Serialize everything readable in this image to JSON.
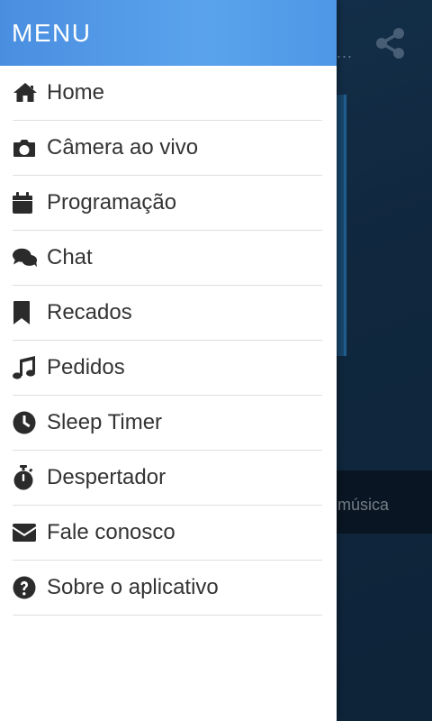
{
  "drawer": {
    "title": "MENU",
    "header_color": "#4e97e6"
  },
  "menu": [
    {
      "label": "Home",
      "icon": "home-icon"
    },
    {
      "label": "Câmera ao vivo",
      "icon": "camera-icon"
    },
    {
      "label": "Programação",
      "icon": "calendar-icon"
    },
    {
      "label": "Chat",
      "icon": "comments-icon"
    },
    {
      "label": "Recados",
      "icon": "bookmark-icon"
    },
    {
      "label": "Pedidos",
      "icon": "music-note-icon"
    },
    {
      "label": "Sleep Timer",
      "icon": "clock-icon"
    },
    {
      "label": "Despertador",
      "icon": "stopwatch-icon"
    },
    {
      "label": "Fale conosco",
      "icon": "envelope-icon"
    },
    {
      "label": "Sobre o aplicativo",
      "icon": "question-circle-icon"
    }
  ],
  "background": {
    "now_playing_text": "a música",
    "overflow_text": "..."
  }
}
